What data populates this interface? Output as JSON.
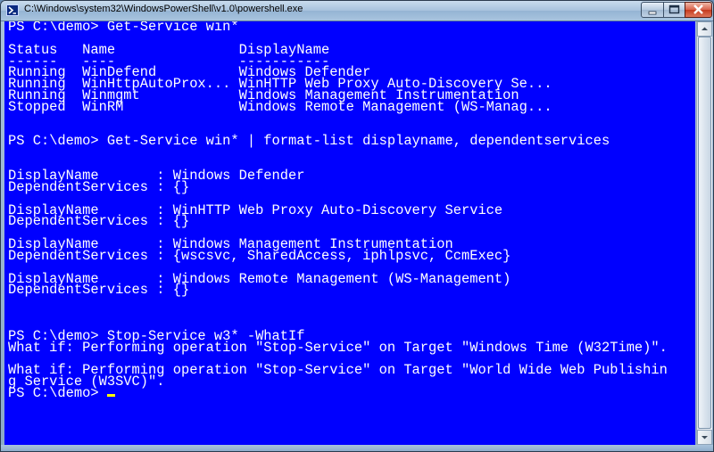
{
  "window": {
    "title": "C:\\Windows\\system32\\WindowsPowerShell\\v1.0\\powershell.exe",
    "icon": "powershell-icon",
    "controls": {
      "minimize": "minimize-icon",
      "maximize": "maximize-icon",
      "close": "close-icon"
    }
  },
  "colors": {
    "console_background": "#0000ff",
    "console_text": "#ffffff",
    "cursor": "#ffff00"
  },
  "console": {
    "lines": [
      "PS C:\\demo> Get-Service win*",
      "",
      "Status   Name               DisplayName",
      "------   ----               -----------",
      "Running  WinDefend          Windows Defender",
      "Running  WinHttpAutoProx... WinHTTP Web Proxy Auto-Discovery Se...",
      "Running  Winmgmt            Windows Management Instrumentation",
      "Stopped  WinRM              Windows Remote Management (WS-Manag...",
      "",
      "",
      "PS C:\\demo> Get-Service win* | format-list displayname, dependentservices",
      "",
      "",
      "DisplayName       : Windows Defender",
      "DependentServices : {}",
      "",
      "DisplayName       : WinHTTP Web Proxy Auto-Discovery Service",
      "DependentServices : {}",
      "",
      "DisplayName       : Windows Management Instrumentation",
      "DependentServices : {wscsvc, SharedAccess, iphlpsvc, CcmExec}",
      "",
      "DisplayName       : Windows Remote Management (WS-Management)",
      "DependentServices : {}",
      "",
      "",
      "",
      "PS C:\\demo> Stop-Service w3* -WhatIf",
      "What if: Performing operation \"Stop-Service\" on Target \"Windows Time (W32Time)\".",
      "",
      "What if: Performing operation \"Stop-Service\" on Target \"World Wide Web Publishin",
      "g Service (W3SVC)\".",
      "PS C:\\demo> "
    ]
  }
}
